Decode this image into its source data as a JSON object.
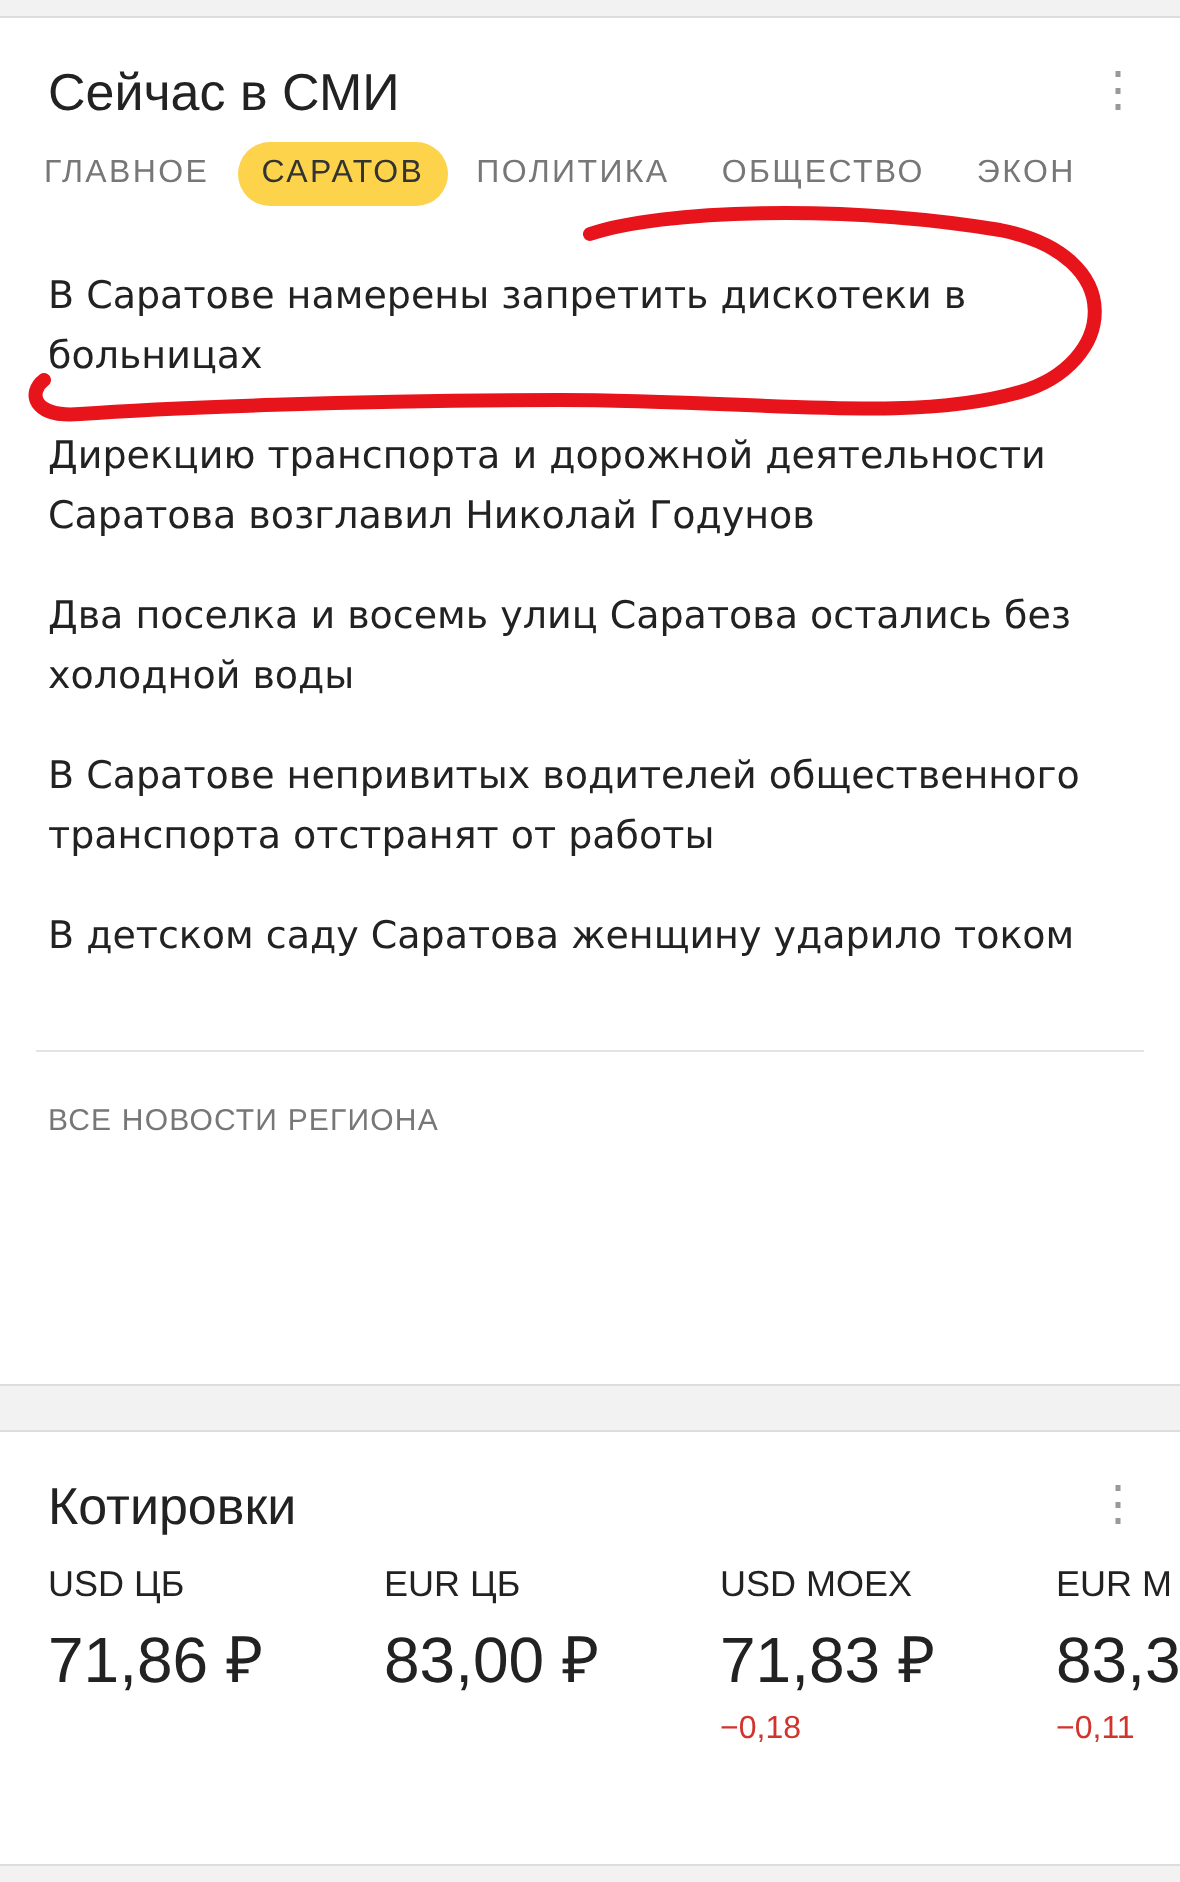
{
  "news_card": {
    "title": "Сейчас в СМИ",
    "menu": "⋮",
    "tabs": [
      {
        "label": "ГЛАВНОЕ",
        "selected": false
      },
      {
        "label": "САРАТОВ",
        "selected": true
      },
      {
        "label": "ПОЛИТИКА",
        "selected": false
      },
      {
        "label": "ОБЩЕСТВО",
        "selected": false
      },
      {
        "label": "ЭКОН",
        "selected": false
      }
    ],
    "headlines": [
      "В Саратове намерены запретить дискотеки в больницах",
      "Дирекцию транспорта и дорожной деятельности Саратова возглавил Николай Годунов",
      "Два поселка и восемь улиц Саратова остались без холодной воды",
      "В Саратове непривитых водителей общественного транспорта отстранят от работы",
      "В детском саду Саратова женщину ударило током"
    ],
    "footer_link": "ВСЕ НОВОСТИ РЕГИОНА"
  },
  "annotation": {
    "kind": "freehand-loop"
  },
  "quotes_card": {
    "title": "Котировки",
    "menu": "⋮",
    "quotes": [
      {
        "name": "USD ЦБ",
        "value": "71,86 ₽"
      },
      {
        "name": "EUR ЦБ",
        "value": "83,00 ₽"
      },
      {
        "name": "USD MOEX",
        "value": "71,83 ₽",
        "change": "−0,18"
      },
      {
        "name": "EUR M",
        "value": "83,3",
        "change": "−0,11"
      }
    ]
  }
}
